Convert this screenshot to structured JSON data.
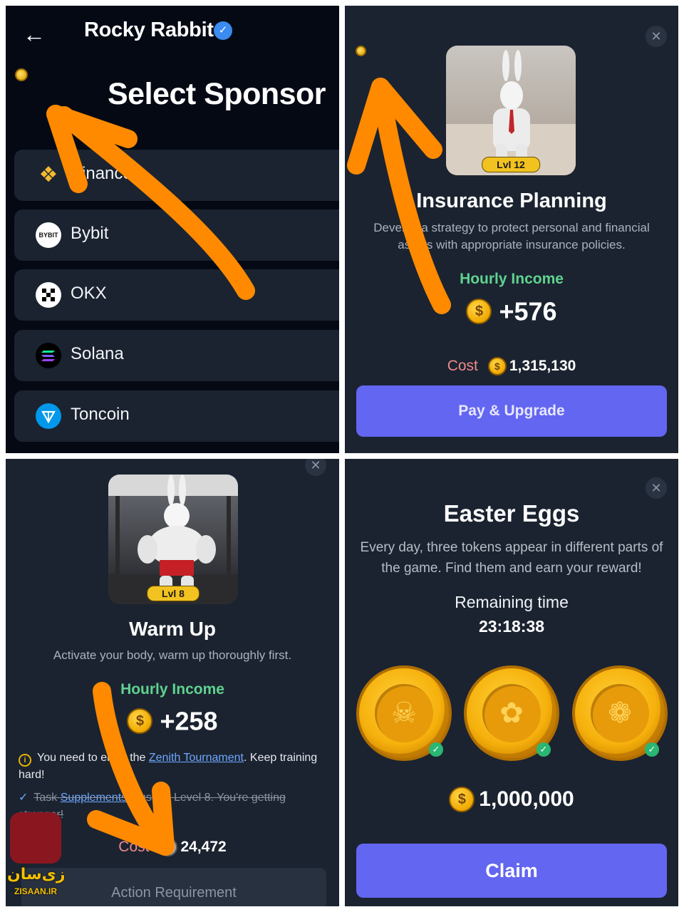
{
  "sponsor_screen": {
    "back_icon": "arrow-left-icon",
    "app_title": "Rocky Rabbit",
    "verified_icon": "verified-check-icon",
    "heading": "Select Sponsor",
    "sponsors": [
      {
        "label": "Binance",
        "logo_text": "",
        "logo_color": "#f3ba2f"
      },
      {
        "label": "Bybit",
        "logo_text": "BYBIT",
        "logo_color": "#ffffff"
      },
      {
        "label": "OKX",
        "logo_text": "",
        "logo_color": "#ffffff"
      },
      {
        "label": "Solana",
        "logo_text": "",
        "logo_color": "#000000"
      },
      {
        "label": "Toncoin",
        "logo_text": "",
        "logo_color": "#0098ea"
      }
    ]
  },
  "insurance_card": {
    "close_icon": "close-icon",
    "image_icon": "rabbit-in-suit-image",
    "level": "Lvl 12",
    "title": "Insurance Planning",
    "description": "Develop a strategy to protect personal and financial assets with appropriate insurance policies.",
    "hourly_income_label": "Hourly Income",
    "hourly_income": "+576",
    "cost_label": "Cost",
    "cost": "1,315,130",
    "button": "Pay & Upgrade"
  },
  "warmup_card": {
    "close_icon": "close-icon",
    "image_icon": "muscular-rabbit-gym-image",
    "level": "Lvl 8",
    "title": "Warm Up",
    "description": "Activate your body, warm up thoroughly first.",
    "hourly_income_label": "Hourly Income",
    "hourly_income": "+258",
    "notice_prefix": "You need to enter the ",
    "notice_link": "Zenith Tournament",
    "notice_suffix": ". Keep training hard!",
    "task_prefix": "Task ",
    "task_link": "Supplements",
    "task_suffix": " must be Level 8. You're getting stronger!",
    "cost_label": "Cost",
    "cost": "24,472",
    "action_requirement": "Action Requirement"
  },
  "easter_card": {
    "close_icon": "close-icon",
    "title": "Easter Eggs",
    "description": "Every day, three tokens appear in different parts of the game. Find them and earn your reward!",
    "remaining_label": "Remaining time",
    "remaining_time": "23:18:38",
    "tokens": [
      {
        "icon": "skull-icon",
        "glyph": "☠"
      },
      {
        "icon": "clover-icon",
        "glyph": "✿"
      },
      {
        "icon": "paw-icon",
        "glyph": "❁"
      }
    ],
    "reward": "1,000,000",
    "button": "Claim"
  },
  "watermark": {
    "logo_text": "زی",
    "name_fa": "زی‌سان",
    "name_en": "ZISAAN.IR"
  },
  "colors": {
    "accent_button": "#6366f1",
    "income_green": "#5fd38f",
    "cost_red": "#f08a8a",
    "arrow_orange": "#ff8a00"
  }
}
